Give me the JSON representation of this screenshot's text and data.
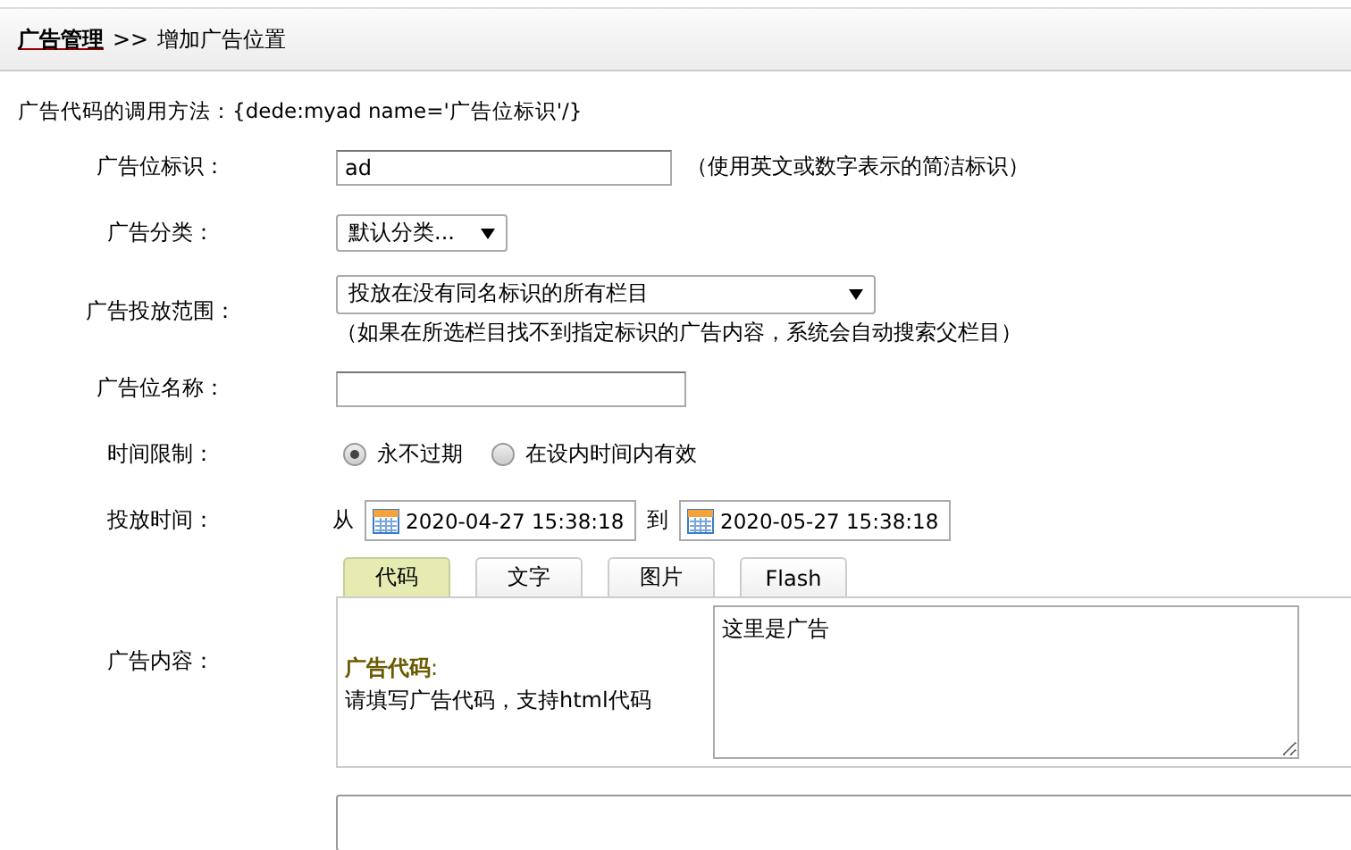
{
  "breadcrumb": {
    "link": "广告管理",
    "separator": ">>",
    "current": "增加广告位置"
  },
  "usage_note": "广告代码的调用方法：{dede:myad name='广告位标识'/}",
  "rows": [
    {
      "kind": "text",
      "label": "广告位标识：",
      "value": "ad",
      "hint": "（使用英文或数字表示的简洁标识）"
    },
    {
      "kind": "select",
      "label": "广告分类：",
      "value": "默认分类..."
    },
    {
      "kind": "select_wide",
      "label": "广告投放范围：",
      "value": "投放在没有同名标识的所有栏目",
      "note": "（如果在所选栏目找不到指定标识的广告内容，系统会自动搜索父栏目）"
    },
    {
      "kind": "text_empty",
      "label": "广告位名称："
    },
    {
      "kind": "radio",
      "label": "时间限制：",
      "options": [
        {
          "label": "永不过期",
          "selected": true
        },
        {
          "label": "在设内时间内有效",
          "selected": false
        }
      ]
    },
    {
      "kind": "daterange",
      "label": "投放时间：",
      "from_label": "从",
      "from": "2020-04-27 15:38:18",
      "to_label": "到",
      "to": "2020-05-27 15:38:18"
    },
    {
      "kind": "content",
      "label": "广告内容：",
      "tabs": [
        {
          "label": "代码",
          "selected": true
        },
        {
          "label": "文字",
          "selected": false
        },
        {
          "label": "图片",
          "selected": false
        },
        {
          "label": "Flash",
          "selected": false
        }
      ],
      "panel_title": "广告代码",
      "panel_colon": ":",
      "panel_hint": "请填写广告代码，支持html代码",
      "code": "这里是广告"
    }
  ]
}
